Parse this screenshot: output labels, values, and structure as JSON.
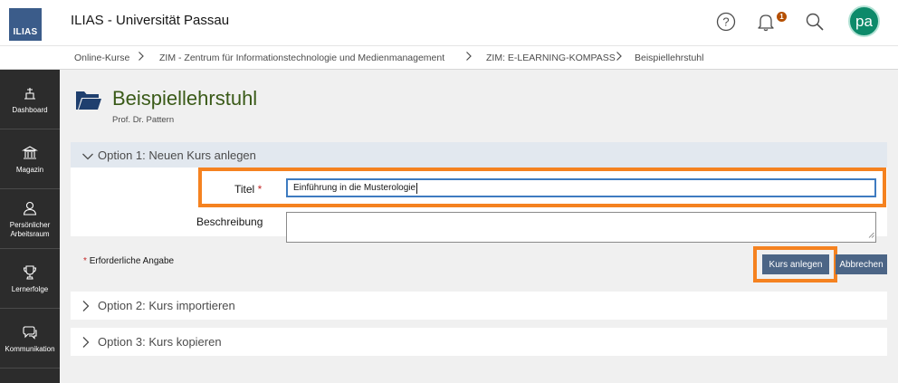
{
  "header": {
    "logo_text": "ILIAS",
    "title": "ILIAS - Universität Passau",
    "notification_count": "1",
    "avatar_initials": "pa",
    "icons": [
      "help-icon",
      "bell-icon",
      "search-icon"
    ]
  },
  "breadcrumb": {
    "items": [
      "Online-Kurse",
      "ZIM - Zentrum für Informationstechnologie und Medienmanagement",
      "ZIM: E-LEARNING-KOMPASS",
      "Beispiellehrstuhl"
    ]
  },
  "sidebar": {
    "items": [
      {
        "label": "Dashboard",
        "icon": "dashboard-icon"
      },
      {
        "label": "Magazin",
        "icon": "repository-icon"
      },
      {
        "label": "Persönlicher Arbeitsraum",
        "icon": "person-icon"
      },
      {
        "label": "Lernerfolge",
        "icon": "trophy-icon"
      },
      {
        "label": "Kommunikation",
        "icon": "chat-icon"
      }
    ]
  },
  "page": {
    "title": "Beispiellehrstuhl",
    "subtitle": "Prof. Dr. Pattern"
  },
  "option1": {
    "title": "Option 1: Neuen Kurs anlegen",
    "title_label": "Titel",
    "required_mark": "*",
    "title_value": "Einführung in die Musterologie",
    "description_label": "Beschreibung",
    "description_value": "",
    "required_note_mark": "*",
    "required_note": "Erforderliche Angabe",
    "create_button": "Kurs anlegen",
    "cancel_button": "Abbrechen"
  },
  "option2": {
    "title": "Option 2: Kurs importieren"
  },
  "option3": {
    "title": "Option 3: Kurs kopieren"
  },
  "colors": {
    "highlight": "#f58220",
    "button": "#4c6586",
    "title_green": "#3a5a18",
    "sidebar": "#2c2c2c",
    "avatar": "#0d8a6a"
  }
}
